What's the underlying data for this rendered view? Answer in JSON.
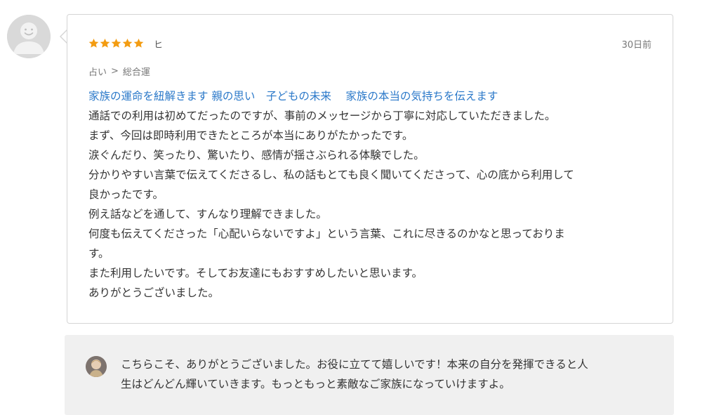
{
  "review": {
    "rating": 5,
    "rating_max": 5,
    "reviewer_name": "ヒ",
    "date": "30日前",
    "breadcrumb": [
      {
        "label": "占い"
      },
      {
        "label": "総合運"
      }
    ],
    "breadcrumb_separator": ">",
    "service_title": "家族の運命を紐解きます 親の思い　子どもの未来　 家族の本当の気持ちを伝えます",
    "body_lines": [
      "通話での利用は初めてだったのですが、事前のメッセージから丁寧に対応していただきました。",
      "まず、今回は即時利用できたところが本当にありがたかったです。",
      "涙ぐんだり、笑ったり、驚いたり、感情が揺さぶられる体験でした。",
      "分かりやすい言葉で伝えてくださるし、私の話もとても良く聞いてくださって、心の底から利用して",
      "良かったです。",
      "例え話などを通して、すんなり理解できました。",
      "何度も伝えてくださった「心配いらないですよ」という言葉、これに尽きるのかなと思っておりま",
      "す。",
      "また利用したいです。そしてお友達にもおすすめしたいと思います。",
      "ありがとうございました。"
    ]
  },
  "reply": {
    "lines": [
      "こちらこそ、ありがとうございました。お役に立てて嬉しいです！本来の自分を発揮できると人",
      "生はどんどん輝いていきます。もっともっと素敵なご家族になっていけますよ。"
    ]
  },
  "colors": {
    "star": "#f39c12",
    "link": "#2a78c9",
    "card_border": "#d5d5d5",
    "reply_background": "#f0f0f0",
    "avatar_placeholder": "#d9d9d9"
  },
  "icons": {
    "reviewer_avatar": "default-user-avatar-icon",
    "reply_avatar": "seller-avatar-icon",
    "star": "star-icon"
  }
}
